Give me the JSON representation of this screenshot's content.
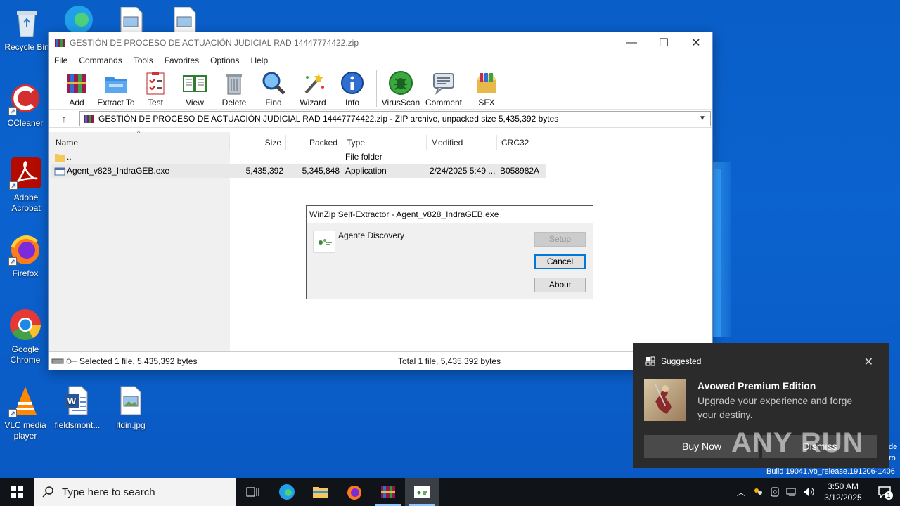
{
  "desktop": {
    "icons": [
      {
        "label": "Recycle Bin"
      },
      {
        "label": "CCleaner"
      },
      {
        "label": "Adobe Acrobat"
      },
      {
        "label": "Firefox"
      },
      {
        "label": "Google Chrome"
      },
      {
        "label": "VLC media player"
      },
      {
        "label": "fieldsmont..."
      },
      {
        "label": "ltdin.jpg"
      }
    ]
  },
  "winrar": {
    "title": "GESTIÓN DE PROCESO DE ACTUACIÓN JUDICIAL RAD 14447774422.zip",
    "menu": [
      "File",
      "Commands",
      "Tools",
      "Favorites",
      "Options",
      "Help"
    ],
    "toolbar": [
      "Add",
      "Extract To",
      "Test",
      "View",
      "Delete",
      "Find",
      "Wizard",
      "Info",
      "VirusScan",
      "Comment",
      "SFX"
    ],
    "address": "GESTIÓN DE PROCESO DE ACTUACIÓN JUDICIAL RAD 14447774422.zip - ZIP archive, unpacked size 5,435,392 bytes",
    "columns": [
      "Name",
      "Size",
      "Packed",
      "Type",
      "Modified",
      "CRC32"
    ],
    "rows": [
      {
        "name": "..",
        "size": "",
        "packed": "",
        "type": "File folder",
        "modified": "",
        "crc": ""
      },
      {
        "name": "Agent_v828_IndraGEB.exe",
        "size": "5,435,392",
        "packed": "5,345,848",
        "type": "Application",
        "modified": "2/24/2025 5:49 ...",
        "crc": "B058982A"
      }
    ],
    "status_left": "Selected 1 file, 5,435,392 bytes",
    "status_right": "Total 1 file, 5,435,392 bytes"
  },
  "dialog": {
    "title": "WinZip Self-Extractor - Agent_v828_IndraGEB.exe",
    "message": "Agente Discovery",
    "setup": "Setup",
    "cancel": "Cancel",
    "about": "About"
  },
  "toast": {
    "header": "Suggested",
    "title": "Avowed Premium Edition",
    "body": "Upgrade your experience and forge your destiny.",
    "buy": "Buy Now",
    "dismiss": "Dismiss"
  },
  "watermark": "ANY RUN",
  "build": "Build 19041.vb_release.191206-1406",
  "side_clip": [
    "de",
    "ro"
  ],
  "taskbar": {
    "search_placeholder": "Type here to search",
    "time": "3:50 AM",
    "date": "3/12/2025",
    "notif_count": "1"
  }
}
